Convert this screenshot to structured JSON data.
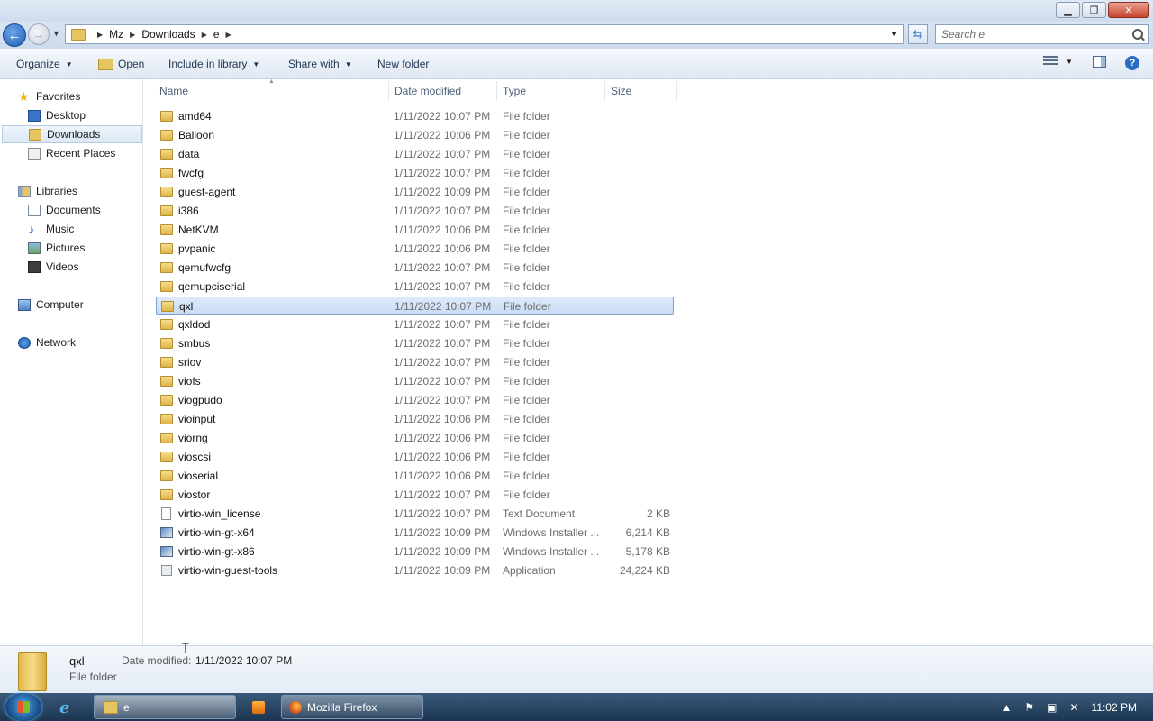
{
  "window": {
    "caption_buttons": {
      "minimize": "▁",
      "maximize": "❐",
      "close": "✕"
    }
  },
  "address": {
    "crumbs": [
      "Mz",
      "Downloads",
      "e"
    ],
    "search_placeholder": "Search e"
  },
  "toolbar": {
    "organize": "Organize",
    "open": "Open",
    "include_in_library": "Include in library",
    "share_with": "Share with",
    "new_folder": "New folder"
  },
  "nav": {
    "favorites": "Favorites",
    "desktop": "Desktop",
    "downloads": "Downloads",
    "recent_places": "Recent Places",
    "libraries": "Libraries",
    "documents": "Documents",
    "music": "Music",
    "pictures": "Pictures",
    "videos": "Videos",
    "computer": "Computer",
    "network": "Network"
  },
  "columns": {
    "name": "Name",
    "date": "Date modified",
    "type": "Type",
    "size": "Size"
  },
  "files": [
    {
      "name": "amd64",
      "date": "1/11/2022 10:07 PM",
      "type": "File folder",
      "size": "",
      "icon": "folder"
    },
    {
      "name": "Balloon",
      "date": "1/11/2022 10:06 PM",
      "type": "File folder",
      "size": "",
      "icon": "folder"
    },
    {
      "name": "data",
      "date": "1/11/2022 10:07 PM",
      "type": "File folder",
      "size": "",
      "icon": "folder"
    },
    {
      "name": "fwcfg",
      "date": "1/11/2022 10:07 PM",
      "type": "File folder",
      "size": "",
      "icon": "folder"
    },
    {
      "name": "guest-agent",
      "date": "1/11/2022 10:09 PM",
      "type": "File folder",
      "size": "",
      "icon": "folder"
    },
    {
      "name": "i386",
      "date": "1/11/2022 10:07 PM",
      "type": "File folder",
      "size": "",
      "icon": "folder"
    },
    {
      "name": "NetKVM",
      "date": "1/11/2022 10:06 PM",
      "type": "File folder",
      "size": "",
      "icon": "folder"
    },
    {
      "name": "pvpanic",
      "date": "1/11/2022 10:06 PM",
      "type": "File folder",
      "size": "",
      "icon": "folder"
    },
    {
      "name": "qemufwcfg",
      "date": "1/11/2022 10:07 PM",
      "type": "File folder",
      "size": "",
      "icon": "folder"
    },
    {
      "name": "qemupciserial",
      "date": "1/11/2022 10:07 PM",
      "type": "File folder",
      "size": "",
      "icon": "folder"
    },
    {
      "name": "qxl",
      "date": "1/11/2022 10:07 PM",
      "type": "File folder",
      "size": "",
      "icon": "folder",
      "selected": true
    },
    {
      "name": "qxldod",
      "date": "1/11/2022 10:07 PM",
      "type": "File folder",
      "size": "",
      "icon": "folder"
    },
    {
      "name": "smbus",
      "date": "1/11/2022 10:07 PM",
      "type": "File folder",
      "size": "",
      "icon": "folder"
    },
    {
      "name": "sriov",
      "date": "1/11/2022 10:07 PM",
      "type": "File folder",
      "size": "",
      "icon": "folder"
    },
    {
      "name": "viofs",
      "date": "1/11/2022 10:07 PM",
      "type": "File folder",
      "size": "",
      "icon": "folder"
    },
    {
      "name": "viogpudo",
      "date": "1/11/2022 10:07 PM",
      "type": "File folder",
      "size": "",
      "icon": "folder"
    },
    {
      "name": "vioinput",
      "date": "1/11/2022 10:06 PM",
      "type": "File folder",
      "size": "",
      "icon": "folder"
    },
    {
      "name": "viorng",
      "date": "1/11/2022 10:06 PM",
      "type": "File folder",
      "size": "",
      "icon": "folder"
    },
    {
      "name": "vioscsi",
      "date": "1/11/2022 10:06 PM",
      "type": "File folder",
      "size": "",
      "icon": "folder"
    },
    {
      "name": "vioserial",
      "date": "1/11/2022 10:06 PM",
      "type": "File folder",
      "size": "",
      "icon": "folder"
    },
    {
      "name": "viostor",
      "date": "1/11/2022 10:07 PM",
      "type": "File folder",
      "size": "",
      "icon": "folder"
    },
    {
      "name": "virtio-win_license",
      "date": "1/11/2022 10:07 PM",
      "type": "Text Document",
      "size": "2 KB",
      "icon": "textdoc"
    },
    {
      "name": "virtio-win-gt-x64",
      "date": "1/11/2022 10:09 PM",
      "type": "Windows Installer ...",
      "size": "6,214 KB",
      "icon": "msi"
    },
    {
      "name": "virtio-win-gt-x86",
      "date": "1/11/2022 10:09 PM",
      "type": "Windows Installer ...",
      "size": "5,178 KB",
      "icon": "msi"
    },
    {
      "name": "virtio-win-guest-tools",
      "date": "1/11/2022 10:09 PM",
      "type": "Application",
      "size": "24,224 KB",
      "icon": "app"
    }
  ],
  "details": {
    "name": "qxl",
    "type": "File folder",
    "date_label": "Date modified:",
    "date_value": "1/11/2022 10:07 PM"
  },
  "taskbar": {
    "explorer_label": "e",
    "firefox_label": "Mozilla Firefox",
    "clock": "11:02 PM"
  },
  "colors": {
    "accent": "#2a6cc4",
    "selection": "#c8dcf5"
  }
}
